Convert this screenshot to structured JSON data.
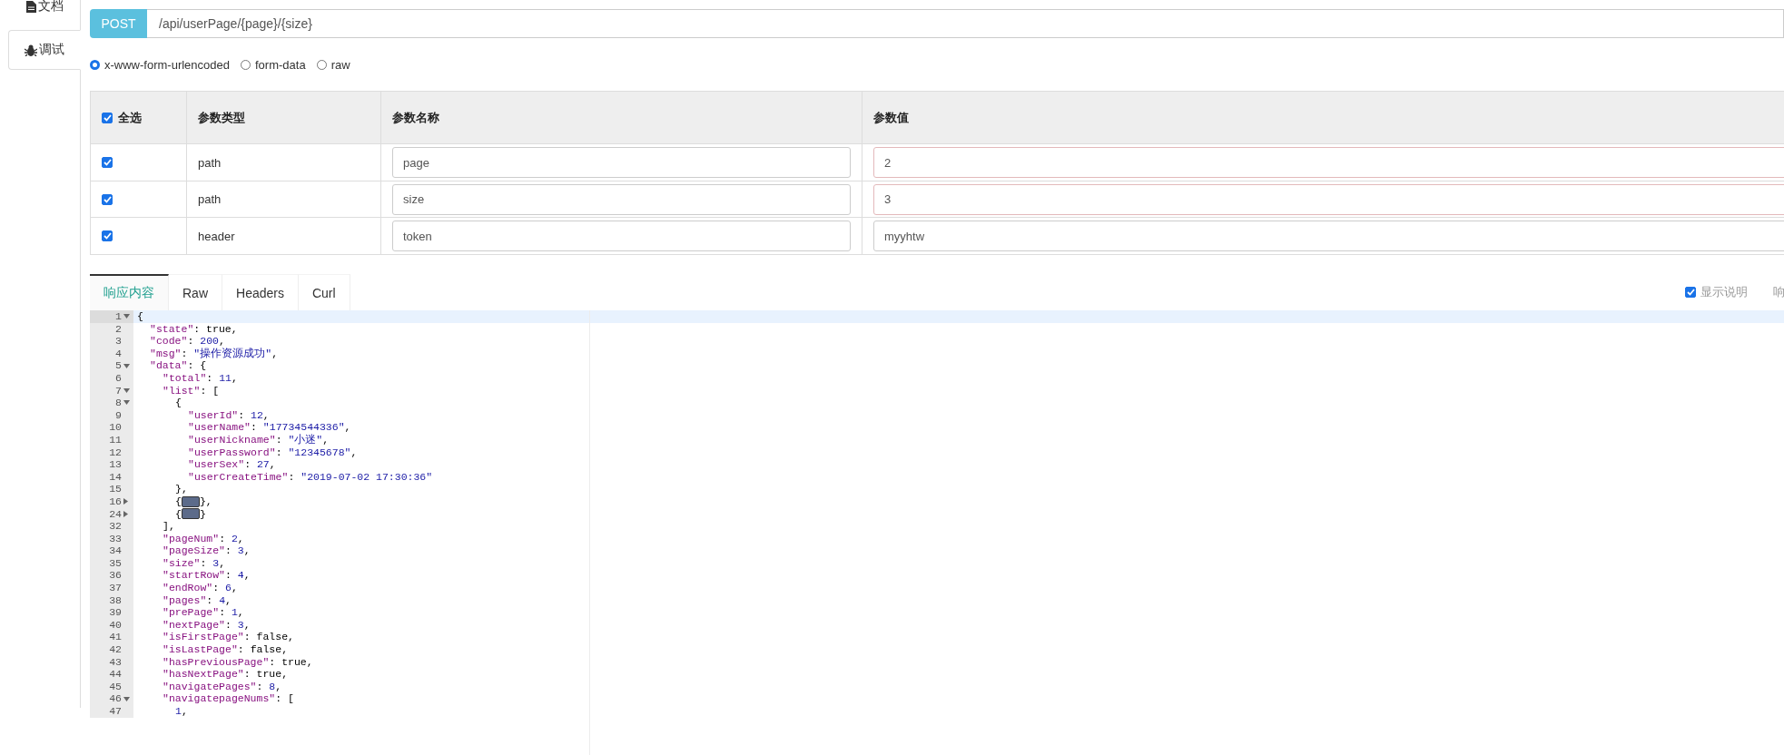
{
  "sidebar": {
    "tabs": [
      {
        "label": "文档",
        "selected": false
      },
      {
        "label": "调试",
        "selected": true
      }
    ]
  },
  "request": {
    "method": "POST",
    "url": "/api/userPage/{page}/{size}"
  },
  "body_types": [
    {
      "label": "x-www-form-urlencoded",
      "selected": true
    },
    {
      "label": "form-data",
      "selected": false
    },
    {
      "label": "raw",
      "selected": false
    }
  ],
  "params_table": {
    "select_all": {
      "label": "全选",
      "checked": true
    },
    "columns": [
      "参数类型",
      "参数名称",
      "参数值"
    ],
    "rows": [
      {
        "checked": true,
        "type": "path",
        "name": "page",
        "value": "2",
        "flagged": true
      },
      {
        "checked": true,
        "type": "path",
        "name": "size",
        "value": "3",
        "flagged": true
      },
      {
        "checked": true,
        "type": "header",
        "name": "token",
        "value": "myyhtw",
        "flagged": false
      }
    ]
  },
  "response": {
    "tabs": [
      {
        "label": "响应内容",
        "selected": true
      },
      {
        "label": "Raw",
        "selected": false
      },
      {
        "label": "Headers",
        "selected": false
      },
      {
        "label": "Curl",
        "selected": false
      }
    ],
    "show_description": {
      "label": "显示说明",
      "checked": true
    },
    "cut_label": "响",
    "lines": [
      {
        "n": "1",
        "expanded": true,
        "text": "{",
        "children": [
          {
            "n": "2",
            "text": "\"state\": true,"
          },
          {
            "n": "3",
            "text": "\"code\": 200,"
          },
          {
            "n": "4",
            "text": "\"msg\": \"操作资源成功\","
          },
          {
            "n": "5",
            "expanded": true,
            "text": "\"data\": {",
            "children": [
              {
                "n": "6",
                "text": "\"total\": 11,"
              },
              {
                "n": "7",
                "expanded": true,
                "text": "\"list\": [",
                "children": [
                  {
                    "n": "8",
                    "expanded": true,
                    "text": "{",
                    "children": [
                      {
                        "n": "9",
                        "text": "\"userId\": 12,"
                      },
                      {
                        "n": "10",
                        "text": "\"userName\": \"17734544336\","
                      },
                      {
                        "n": "11",
                        "text": "\"userNickname\": \"小迷\","
                      },
                      {
                        "n": "12",
                        "text": "\"userPassword\": \"12345678\","
                      },
                      {
                        "n": "13",
                        "text": "\"userSex\": 27,"
                      },
                      {
                        "n": "14",
                        "text": "\"userCreateTime\": \"2019-07-02 17:30:36\""
                      }
                    ]
                  },
                  {
                    "n": "15",
                    "text": "},"
                  },
                  {
                    "n": "16",
                    "expanded": false,
                    "text": "{",
                    "after": "},"
                  },
                  {
                    "n": "24",
                    "expanded": false,
                    "text": "{",
                    "after": "}"
                  }
                ]
              },
              {
                "n": "32",
                "text": "],"
              },
              {
                "n": "33",
                "text": "\"pageNum\": 2,"
              },
              {
                "n": "34",
                "text": "\"pageSize\": 3,"
              },
              {
                "n": "35",
                "text": "\"size\": 3,"
              },
              {
                "n": "36",
                "text": "\"startRow\": 4,"
              },
              {
                "n": "37",
                "text": "\"endRow\": 6,"
              },
              {
                "n": "38",
                "text": "\"pages\": 4,"
              },
              {
                "n": "39",
                "text": "\"prePage\": 1,"
              },
              {
                "n": "40",
                "text": "\"nextPage\": 3,"
              },
              {
                "n": "41",
                "text": "\"isFirstPage\": false,"
              },
              {
                "n": "42",
                "text": "\"isLastPage\": false,"
              },
              {
                "n": "43",
                "text": "\"hasPreviousPage\": true,"
              },
              {
                "n": "44",
                "text": "\"hasNextPage\": true,"
              },
              {
                "n": "45",
                "text": "\"navigatePages\": 8,"
              },
              {
                "n": "46",
                "expanded": true,
                "text": "\"navigatepageNums\": [",
                "children": [
                  {
                    "n": "47",
                    "text": "1,"
                  }
                ]
              }
            ]
          }
        ]
      }
    ]
  }
}
